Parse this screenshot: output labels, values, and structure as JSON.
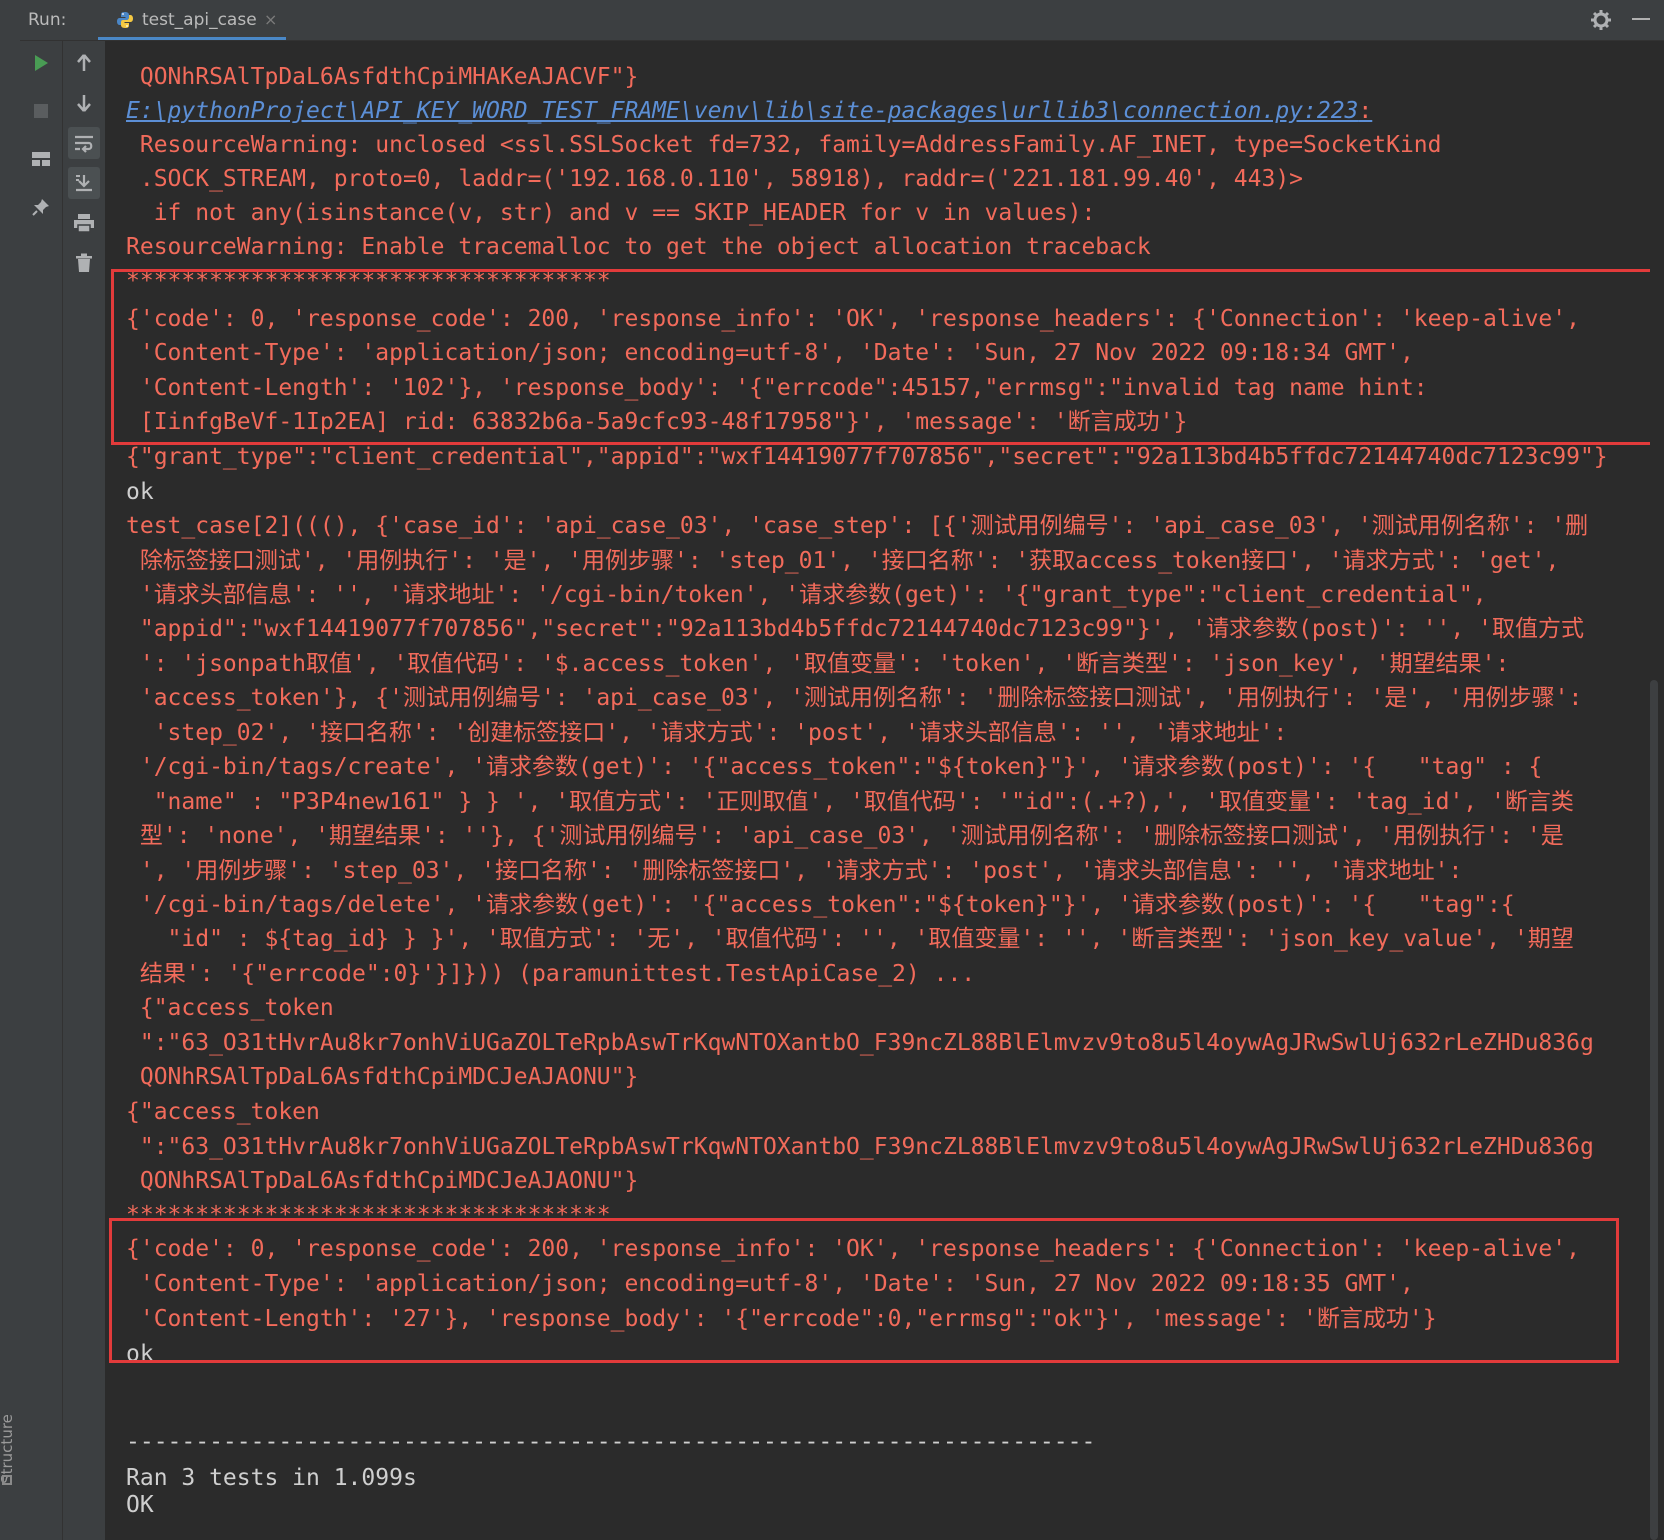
{
  "header": {
    "run_label": "Run:",
    "tab_title": "test_api_case",
    "tab_close": "×"
  },
  "sidebar": {
    "structure_label": "Structure",
    "bottom_label": "s"
  },
  "toolbar": {
    "rerun": "rerun-icon",
    "stop": "stop-icon",
    "layout": "layout-icon",
    "pin": "pin-icon",
    "up": "arrow-up-icon",
    "down": "arrow-down-icon",
    "wrap": "soft-wrap-icon",
    "scroll_end": "scroll-to-end-icon",
    "print": "print-icon",
    "clear": "trash-icon"
  },
  "console": {
    "lines": [
      " QONhRSAlTpDaL6AsfdthCpiMHAKeAJACVF\"}",
      "E:\\pythonProject\\API_KEY_WORD_TEST_FRAME\\venv\\lib\\site-packages\\urllib3\\connection.py:223",
      " ResourceWarning: unclosed <ssl.SSLSocket fd=732, family=AddressFamily.AF_INET, type=SocketKind",
      " .SOCK_STREAM, proto=0, laddr=('192.168.0.110', 58918), raddr=('221.181.99.40', 443)>",
      "  if not any(isinstance(v, str) and v == SKIP_HEADER for v in values):",
      "ResourceWarning: Enable tracemalloc to get the object allocation traceback",
      "***********************************",
      "{'code': 0, 'response_code': 200, 'response_info': 'OK', 'response_headers': {'Connection': 'keep-alive',",
      " 'Content-Type': 'application/json; encoding=utf-8', 'Date': 'Sun, 27 Nov 2022 09:18:34 GMT',",
      " 'Content-Length': '102'}, 'response_body': '{\"errcode\":45157,\"errmsg\":\"invalid tag name hint:",
      " [IinfgBeVf-1Ip2EA] rid: 63832b6a-5a9cfc93-48f17958\"}', 'message': '断言成功'}",
      "{\"grant_type\":\"client_credential\",\"appid\":\"wxf14419077f707856\",\"secret\":\"92a113bd4b5ffdc72144740dc7123c99\"}",
      "ok",
      "test_case[2](((), {'case_id': 'api_case_03', 'case_step': [{'测试用例编号': 'api_case_03', '测试用例名称': '删",
      " 除标签接口测试', '用例执行': '是', '用例步骤': 'step_01', '接口名称': '获取access_token接口', '请求方式': 'get',",
      " '请求头部信息': '', '请求地址': '/cgi-bin/token', '请求参数(get)': '{\"grant_type\":\"client_credential\",",
      " \"appid\":\"wxf14419077f707856\",\"secret\":\"92a113bd4b5ffdc72144740dc7123c99\"}', '请求参数(post)': '', '取值方式",
      " ': 'jsonpath取值', '取值代码': '$.access_token', '取值变量': 'token', '断言类型': 'json_key', '期望结果':",
      " 'access_token'}, {'测试用例编号': 'api_case_03', '测试用例名称': '删除标签接口测试', '用例执行': '是', '用例步骤':",
      "  'step_02', '接口名称': '创建标签接口', '请求方式': 'post', '请求头部信息': '', '请求地址':",
      " '/cgi-bin/tags/create', '请求参数(get)': '{\"access_token\":\"${token}\"}', '请求参数(post)': '{   \"tag\" : {",
      "  \"name\" : \"P3P4new161\" } } ', '取值方式': '正则取值', '取值代码': '\"id\":(.+?),', '取值变量': 'tag_id', '断言类",
      " 型': 'none', '期望结果': ''}, {'测试用例编号': 'api_case_03', '测试用例名称': '删除标签接口测试', '用例执行': '是",
      " ', '用例步骤': 'step_03', '接口名称': '删除标签接口', '请求方式': 'post', '请求头部信息': '', '请求地址':",
      " '/cgi-bin/tags/delete', '请求参数(get)': '{\"access_token\":\"${token}\"}', '请求参数(post)': '{   \"tag\":{",
      "   \"id\" : ${tag_id} } }', '取值方式': '无', '取值代码': '', '取值变量': '', '断言类型': 'json_key_value', '期望",
      " 结果': '{\"errcode\":0}'}]})) (paramunittest.TestApiCase_2) ...",
      " {\"access_token",
      " \":\"63_O31tHvrAu8kr7onhViUGaZOLTeRpbAswTrKqwNTOXantbO_F39ncZL88BlElmvzv9to8u5l4oywAgJRwSwlUj632rLeZHDu836g",
      " QONhRSAlTpDaL6AsfdthCpiMDCJeAJAONU\"}",
      "{\"access_token",
      " \":\"63_O31tHvrAu8kr7onhViUGaZOLTeRpbAswTrKqwNTOXantbO_F39ncZL88BlElmvzv9to8u5l4oywAgJRwSwlUj632rLeZHDu836g",
      " QONhRSAlTpDaL6AsfdthCpiMDCJeAJAONU\"}",
      "***********************************",
      "{'code': 0, 'response_code': 200, 'response_info': 'OK', 'response_headers': {'Connection': 'keep-alive',",
      " 'Content-Type': 'application/json; encoding=utf-8', 'Date': 'Sun, 27 Nov 2022 09:18:35 GMT',",
      " 'Content-Length': '27'}, 'response_body': '{\"errcode\":0,\"errmsg\":\"ok\"}', 'message': '断言成功'}",
      "ok",
      "",
      "----------------------------------------------------------------------",
      "Ran 3 tests in 1.099s",
      "",
      "OK"
    ],
    "link_suffix": ":"
  }
}
